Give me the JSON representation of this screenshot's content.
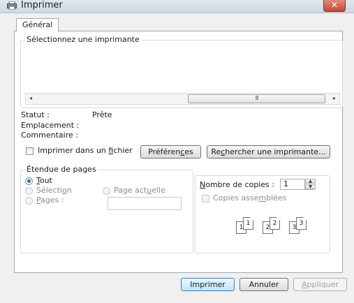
{
  "window": {
    "title": "Imprimer",
    "close_glyph": "✕"
  },
  "tabs": [
    {
      "label": "Général"
    }
  ],
  "select_printer": {
    "legend": "Sélectionnez une imprimante",
    "scrollbar": {
      "left_arrow": "◂",
      "right_arrow": "▸",
      "thumb_grip": "III"
    },
    "status_label": "Statut :",
    "status_value": "Prête",
    "location_label": "Emplacement :",
    "comment_label": "Commentaire :",
    "print_to_file": {
      "label_before": "Imprimer dans un ",
      "label_underline": "f",
      "label_after": "ichier",
      "checked": false
    },
    "preferences_button": {
      "before": "Préféren",
      "underline": "c",
      "after": "es"
    },
    "find_printer_button": {
      "before": "Re",
      "underline": "c",
      "after": "hercher une imprimante..."
    }
  },
  "page_range": {
    "legend": "Étendue de pages",
    "all": {
      "underline": "T",
      "after": "out",
      "checked": true
    },
    "selection": {
      "before": "Sélecti",
      "underline": "o",
      "after": "n"
    },
    "current_page": {
      "before": "Page act",
      "underline": "u",
      "after": "elle"
    },
    "pages": {
      "underline": "P",
      "after": "ages :"
    },
    "pages_input_value": ""
  },
  "copies": {
    "label_underline": "N",
    "label_after": "ombre de copies :",
    "value": "1",
    "spin_up": "▲",
    "spin_down": "▼",
    "collate": {
      "before": "Copies asse",
      "underline": "m",
      "after": "blées",
      "checked": false
    },
    "collate_pages": [
      "1",
      "1",
      "2",
      "2",
      "3",
      "3"
    ]
  },
  "buttons": {
    "print": "Imprimer",
    "cancel": "Annuler",
    "apply": {
      "underline": "A",
      "after": "ppliquer"
    }
  },
  "colors": {
    "accent": "#3c7fb1",
    "close_red": "#c24a35"
  },
  "icons": {
    "title": "printer-icon",
    "close": "close-icon"
  }
}
